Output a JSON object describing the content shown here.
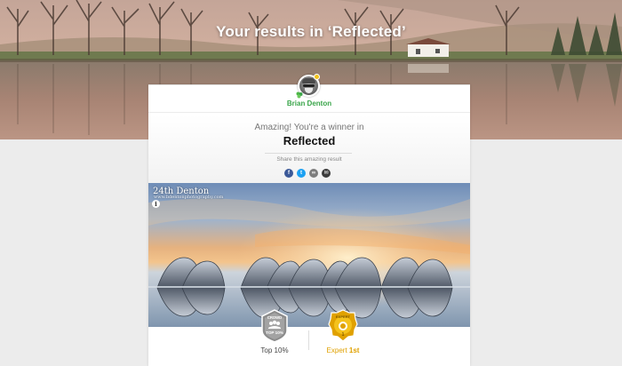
{
  "page": {
    "title": "Your results in ‘Reflected’"
  },
  "user": {
    "name": "Brian Denton",
    "avatar_icon": "user-avatar-icon"
  },
  "result": {
    "message": "Amazing! You're a winner in",
    "challenge_name": "Reflected"
  },
  "share": {
    "label": "Share this amazing result",
    "buttons": [
      {
        "name": "facebook",
        "glyph": "f",
        "color": "#3b5998"
      },
      {
        "name": "twitter",
        "glyph": "t",
        "color": "#1da1f2"
      },
      {
        "name": "link",
        "glyph": "∞",
        "color": "#7d7d7d"
      },
      {
        "name": "email",
        "glyph": "✉",
        "color": "#3c3c3c"
      }
    ]
  },
  "photo": {
    "watermark": "24th Denton",
    "watermark_sub": "www.bdentonphotography.com",
    "info_glyph": "i"
  },
  "achievements": [
    {
      "badge_text": "CROWD",
      "rank_text": "TOP 10%",
      "label_prefix": "Top 10%",
      "label_suffix": "",
      "color": "#7e7e7e"
    },
    {
      "badge_text": "EXPERT",
      "rank_text": "1",
      "label_prefix": "Expert ",
      "label_suffix": "1st",
      "color": "#e0a100"
    }
  ]
}
